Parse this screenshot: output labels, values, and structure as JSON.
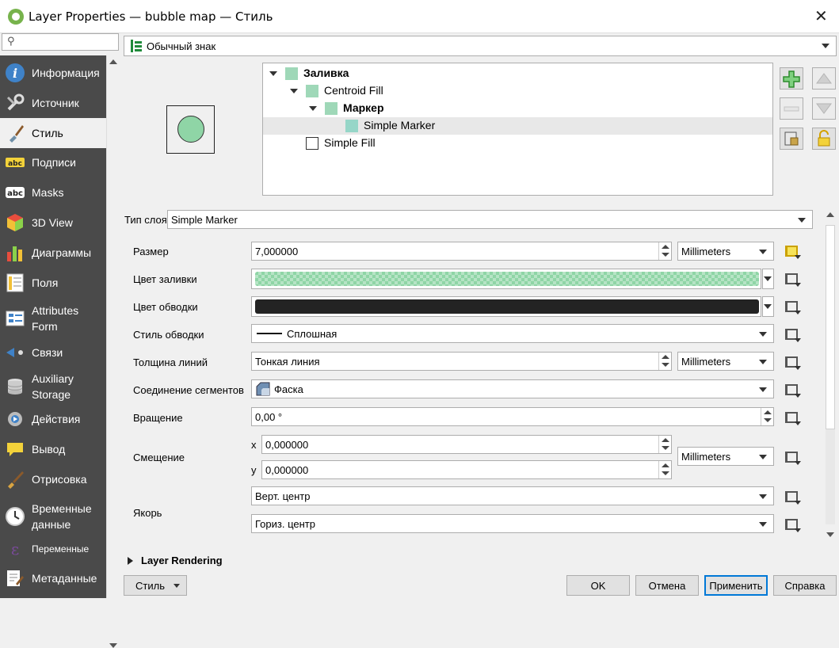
{
  "window": {
    "title": "Layer Properties — bubble map — Стиль",
    "close_glyph": "✕"
  },
  "search": {
    "placeholder": "",
    "icon": "search-icon"
  },
  "sidebar": {
    "items": [
      {
        "label": "Информация",
        "icon": "info-icon",
        "active": false
      },
      {
        "label": "Источник",
        "icon": "source-wrench-icon",
        "active": false
      },
      {
        "label": "Стиль",
        "icon": "paintbrush-icon",
        "active": true
      },
      {
        "label": "Подписи",
        "icon": "labels-abc-icon",
        "active": false
      },
      {
        "label": "Masks",
        "icon": "masks-abc-icon",
        "active": false
      },
      {
        "label": "3D View",
        "icon": "cube-3d-icon",
        "active": false
      },
      {
        "label": "Диаграммы",
        "icon": "diagrams-icon",
        "active": false
      },
      {
        "label": "Поля",
        "icon": "fields-icon",
        "active": false
      },
      {
        "label": "Attributes\nForm",
        "icon": "attributes-form-icon",
        "active": false
      },
      {
        "label": "Связи",
        "icon": "joins-icon",
        "active": false
      },
      {
        "label": "Auxiliary\nStorage",
        "icon": "database-icon",
        "active": false
      },
      {
        "label": "Действия",
        "icon": "actions-gear-icon",
        "active": false
      },
      {
        "label": "Вывод",
        "icon": "display-bubble-icon",
        "active": false
      },
      {
        "label": "Отрисовка",
        "icon": "rendering-brush-icon",
        "active": false
      },
      {
        "label": "Временные\nданные",
        "icon": "clock-icon",
        "active": false
      },
      {
        "label": "Переменные",
        "icon": "variables-epsilon-icon",
        "active": false
      },
      {
        "label": "Метаданные",
        "icon": "metadata-pen-icon",
        "active": false
      }
    ]
  },
  "renderer_combo": {
    "value": "Обычный знак",
    "icon": "single-symbol-icon"
  },
  "symbol_tree": [
    {
      "label": "Заливка",
      "bold": true,
      "level": 0,
      "expand": "expanded",
      "swatch": "#9fd8b8"
    },
    {
      "label": "Centroid Fill",
      "bold": false,
      "level": 1,
      "expand": "expanded",
      "swatch": "#9fd8b8"
    },
    {
      "label": "Маркер",
      "bold": true,
      "level": 2,
      "expand": "expanded",
      "swatch": "#9fd8b8"
    },
    {
      "label": "Simple Marker",
      "bold": false,
      "level": 3,
      "expand": "none",
      "swatch": "#96d6c8",
      "selected": true
    },
    {
      "label": "Simple Fill",
      "bold": false,
      "level": 1,
      "expand": "none",
      "swatch": "#ffffff"
    }
  ],
  "tree_buttons": [
    "add-layer-icon",
    "move-up-icon",
    "remove-layer-icon",
    "move-down-icon",
    "duplicate-layer-icon",
    "lock-icon"
  ],
  "colors": {
    "fill": "#8fd5a6",
    "stroke": "#232323",
    "sidebar": "#4a4a4a",
    "accent": "#0078d7"
  },
  "layer_type": {
    "label": "Тип слоя",
    "value": "Simple Marker"
  },
  "props": {
    "size": {
      "label": "Размер",
      "value": "7,000000",
      "unit": "Millimeters"
    },
    "fill_color": {
      "label": "Цвет заливки"
    },
    "stroke_color": {
      "label": "Цвет обводки"
    },
    "stroke_style": {
      "label": "Стиль обводки",
      "value": "Сплошная"
    },
    "stroke_width": {
      "label": "Толщина линий",
      "value": "Тонкая линия",
      "unit": "Millimeters"
    },
    "join_style": {
      "label": "Соединение сегментов",
      "value": "Фаска"
    },
    "rotation": {
      "label": "Вращение",
      "value": "0,00 °"
    },
    "offset": {
      "label": "Смещение",
      "x_label": "x",
      "y_label": "y",
      "x": "0,000000",
      "y": "0,000000",
      "unit": "Millimeters"
    },
    "anchor": {
      "label": "Якорь",
      "vertical": "Верт. центр",
      "horizontal": "Гориз. центр"
    }
  },
  "layer_rendering": {
    "label": "Layer Rendering"
  },
  "footer": {
    "style_button": "Стиль",
    "ok": "OK",
    "cancel": "Отмена",
    "apply": "Применить",
    "help": "Справка"
  }
}
